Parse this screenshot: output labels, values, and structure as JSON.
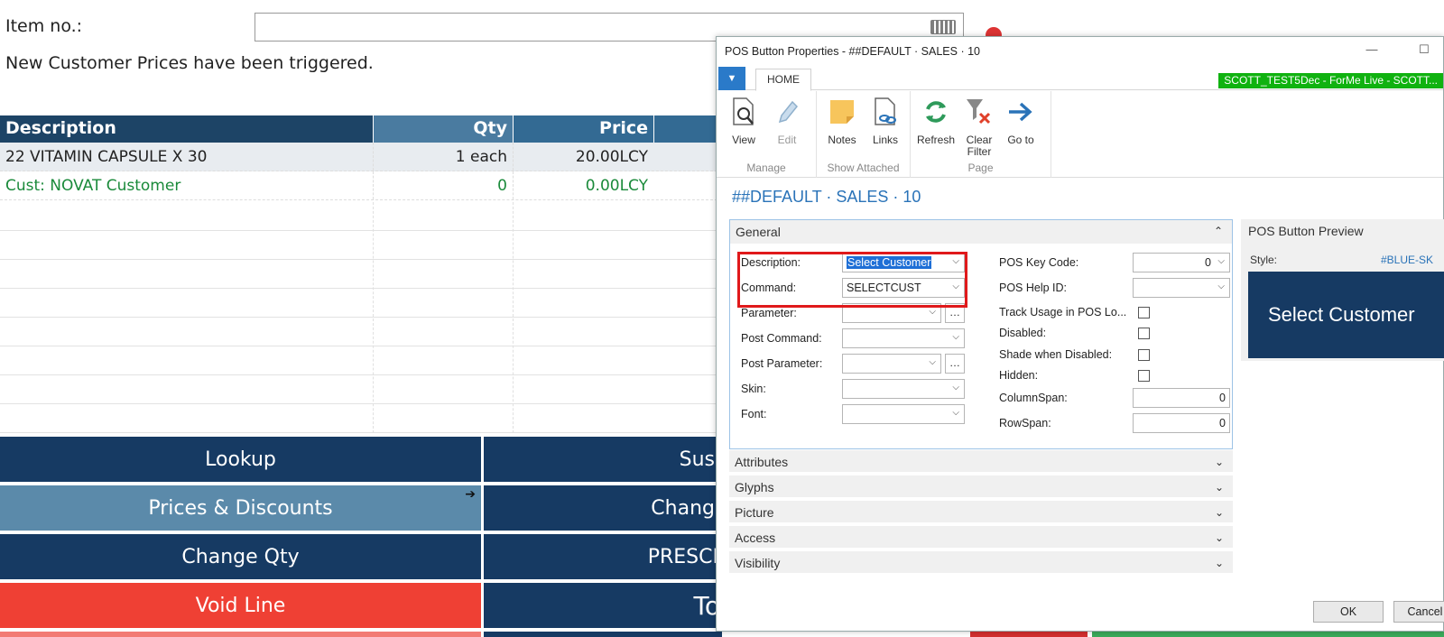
{
  "pos": {
    "item_no_label": "Item no.:",
    "message": "New Customer Prices have been triggered.",
    "grid": {
      "headers": {
        "description": "Description",
        "qty": "Qty",
        "price": "Price"
      },
      "rows": [
        {
          "description": "22 VITAMIN CAPSULE  X 30",
          "qty": "1 each",
          "price": "20.00LCY"
        },
        {
          "description": "Cust: NOVAT  Customer",
          "qty": "0",
          "price": "0.00LCY"
        }
      ]
    },
    "buttons": {
      "lookup": "Lookup",
      "prices_discounts": "Prices & Discounts",
      "change_qty": "Change Qty",
      "void_line": "Void Line",
      "sus": "Sus",
      "chang": "Chang",
      "presci": "PRESCI",
      "to": "To"
    }
  },
  "dialog": {
    "title": "POS Button Properties - ##DEFAULT · SALES · 10",
    "ribbon": {
      "home_tab": "HOME",
      "env_badge": "SCOTT_TEST5Dec - ForMe Live - SCOTT...",
      "groups": [
        {
          "label": "Manage",
          "buttons": [
            {
              "label": "View"
            },
            {
              "label": "Edit"
            }
          ]
        },
        {
          "label": "Show Attached",
          "buttons": [
            {
              "label": "Notes"
            },
            {
              "label": "Links"
            }
          ]
        },
        {
          "label": "Page",
          "buttons": [
            {
              "label": "Refresh"
            },
            {
              "label": "Clear Filter"
            },
            {
              "label": "Go to"
            }
          ]
        }
      ]
    },
    "page_title": "##DEFAULT · SALES · 10",
    "general": {
      "header": "General",
      "left_fields": {
        "description": {
          "label": "Description:",
          "value": "Select Customer"
        },
        "command": {
          "label": "Command:",
          "value": "SELECTCUST"
        },
        "parameter": {
          "label": "Parameter:",
          "value": ""
        },
        "post_command": {
          "label": "Post Command:",
          "value": ""
        },
        "post_parameter": {
          "label": "Post Parameter:",
          "value": ""
        },
        "skin": {
          "label": "Skin:",
          "value": ""
        },
        "font": {
          "label": "Font:",
          "value": ""
        }
      },
      "right_fields": {
        "pos_key_code": {
          "label": "POS Key Code:",
          "value": "0"
        },
        "pos_help_id": {
          "label": "POS Help ID:",
          "value": ""
        },
        "track_usage": {
          "label": "Track Usage in POS Lo...",
          "checked": false
        },
        "disabled": {
          "label": "Disabled:",
          "checked": false
        },
        "shade_when_disabled": {
          "label": "Shade when Disabled:",
          "checked": false
        },
        "hidden": {
          "label": "Hidden:",
          "checked": false
        },
        "column_span": {
          "label": "ColumnSpan:",
          "value": "0"
        },
        "row_span": {
          "label": "RowSpan:",
          "value": "0"
        }
      }
    },
    "fasttabs": [
      "Attributes",
      "Glyphs",
      "Picture",
      "Access",
      "Visibility"
    ],
    "preview": {
      "title": "POS Button Preview",
      "style_label": "Style:",
      "style_value": "#BLUE-SK",
      "button_text": "Select Customer"
    },
    "ok_label": "OK",
    "cancel_label": "Cancel"
  },
  "colors": {
    "pos_dark_blue": "#163a63",
    "pos_light_blue": "#5b8aaa",
    "void_red": "#ef4034",
    "highlight_red": "#e0191b",
    "env_green": "#10b210",
    "title_blue": "#2a73b8"
  }
}
